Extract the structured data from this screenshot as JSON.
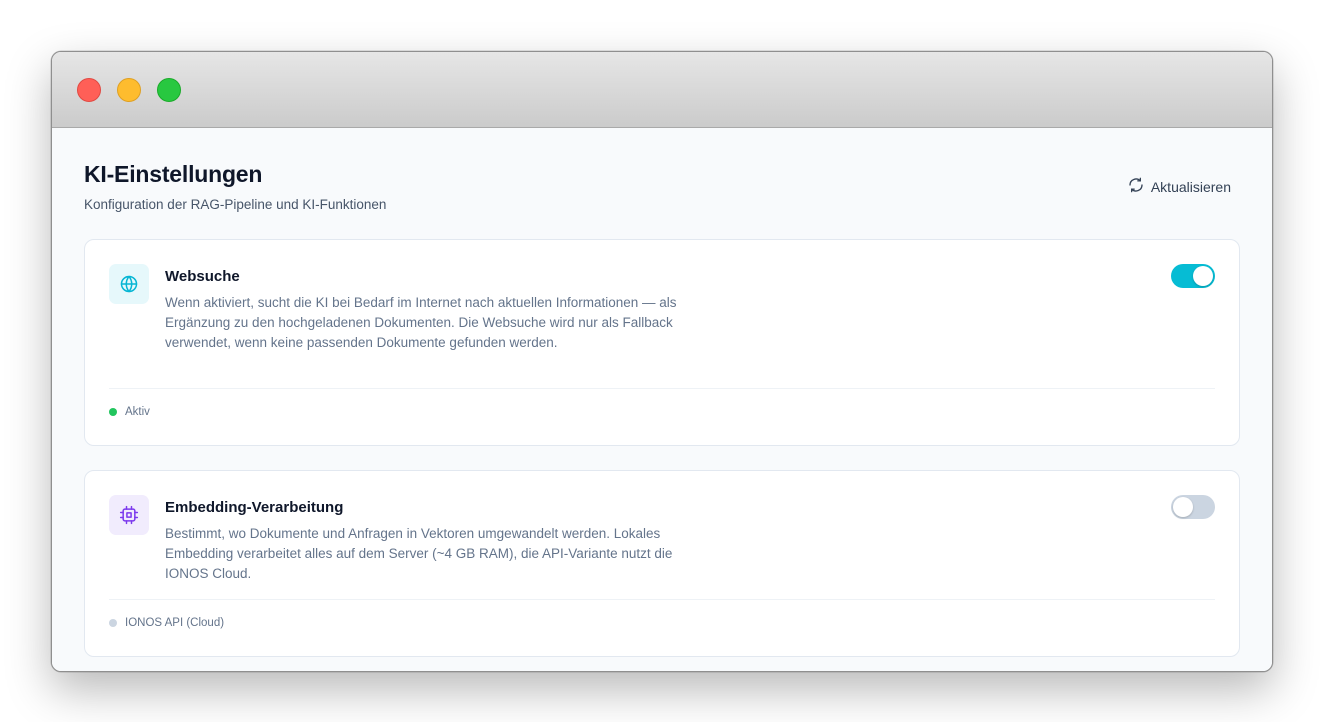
{
  "colors": {
    "accent": "#06bcd4",
    "status_active": "#22c55e",
    "status_inactive": "#cbd5e1",
    "purple_icon": "#7c3aed"
  },
  "header": {
    "title": "KI-Einstellungen",
    "subtitle": "Konfiguration der RAG-Pipeline und KI-Funktionen",
    "refresh_label": "Aktualisieren",
    "refresh_icon": "refresh-icon"
  },
  "cards": [
    {
      "icon": "globe-icon",
      "title": "Websuche",
      "description": "Wenn aktiviert, sucht die KI bei Bedarf im Internet nach aktuellen Informationen — als Ergänzung zu den hochgeladenen Dokumenten. Die Websuche wird nur als Fallback verwendet, wenn keine passenden Dokumente gefunden werden.",
      "enabled": true,
      "status": "Aktiv"
    },
    {
      "icon": "cpu-icon",
      "title": "Embedding-Verarbeitung",
      "description": "Bestimmt, wo Dokumente und Anfragen in Vektoren umgewandelt werden. Lokales Embedding verarbeitet alles auf dem Server (~4 GB RAM), die API-Variante nutzt die IONOS Cloud.",
      "enabled": false,
      "status": "IONOS API (Cloud)"
    }
  ]
}
